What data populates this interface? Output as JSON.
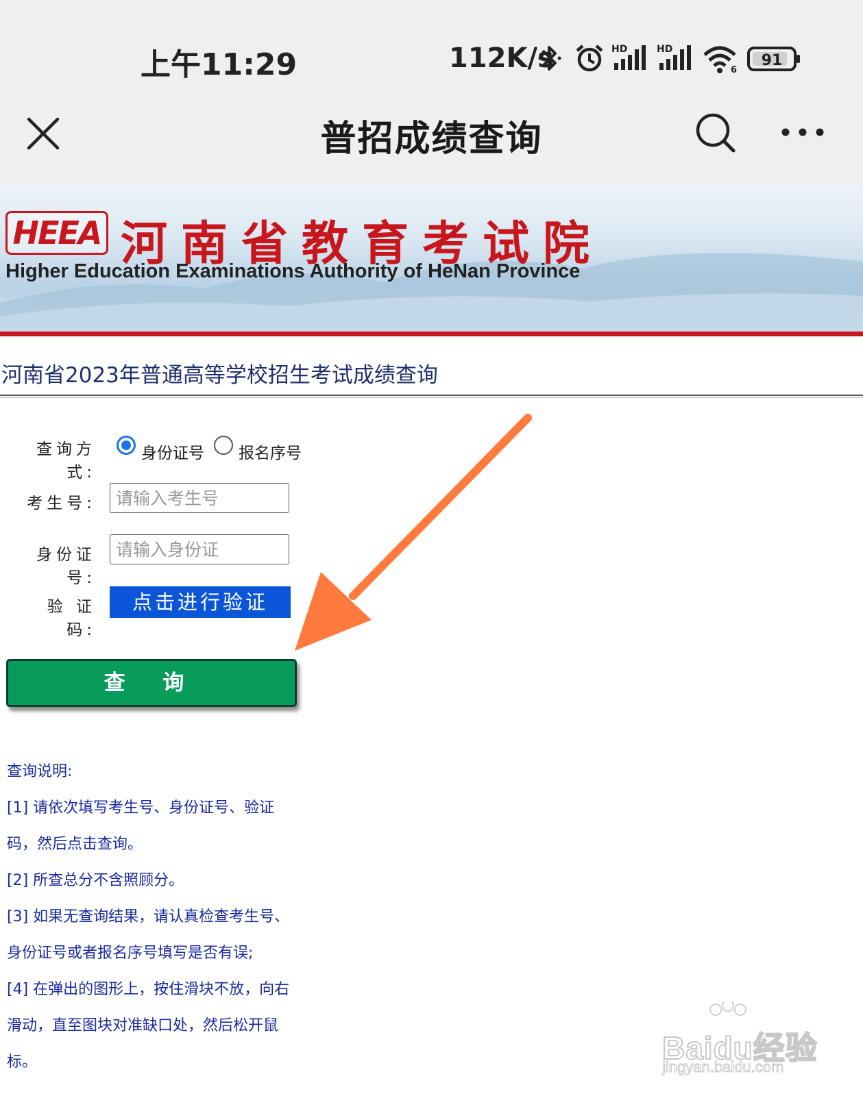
{
  "status_bar": {
    "time": "上午11:29",
    "net_speed": "112K/s",
    "signal_tag_1": "HD",
    "signal_tag_2": "HD",
    "wifi_tag": "6",
    "battery": "91",
    "icons": [
      "bluetooth-icon",
      "alarm-icon",
      "signal-icon",
      "signal-icon",
      "wifi-icon",
      "battery-icon"
    ]
  },
  "nav": {
    "title": "普招成绩查询",
    "icons": [
      "close-icon",
      "search-icon",
      "more-icon"
    ]
  },
  "banner": {
    "logo_text": "HEEA",
    "title": "河南省教育考试院",
    "subtitle": "Higher Education Examinations Authority of HeNan Province",
    "accent_color": "#c8161d"
  },
  "page": {
    "heading": "河南省2023年普通高等学校招生考试成绩查询"
  },
  "form": {
    "method_label": "查询方式:",
    "method_options": [
      {
        "label": "身份证号",
        "selected": true
      },
      {
        "label": "报名序号",
        "selected": false
      }
    ],
    "exam_no_label": "考生号:",
    "exam_no_placeholder": "请输入考生号",
    "id_label": "身份证号:",
    "id_placeholder": "请输入身份证",
    "captcha_label": "验 证 码:",
    "verify_button": "点击进行验证",
    "query_button": "查 询",
    "verify_color": "#0a55d8",
    "query_color": "#079b5c"
  },
  "instructions": {
    "title": "查询说明:",
    "lines": [
      "[1] 请依次填写考生号、身份证号、验证",
      "码，然后点击查询。",
      "[2] 所查总分不含照顾分。",
      "[3] 如果无查询结果，请认真检查考生号、",
      "身份证号或者报名序号填写是否有误;",
      "[4] 在弹出的图形上，按住滑块不放，向右",
      "滑动，直至图块对准缺口处，然后松开鼠",
      "标。"
    ]
  },
  "annotation": {
    "arrow_color": "#ff7a3d"
  },
  "watermark": {
    "brand": "Baidu经验",
    "url": "jingyan.baidu.com"
  }
}
